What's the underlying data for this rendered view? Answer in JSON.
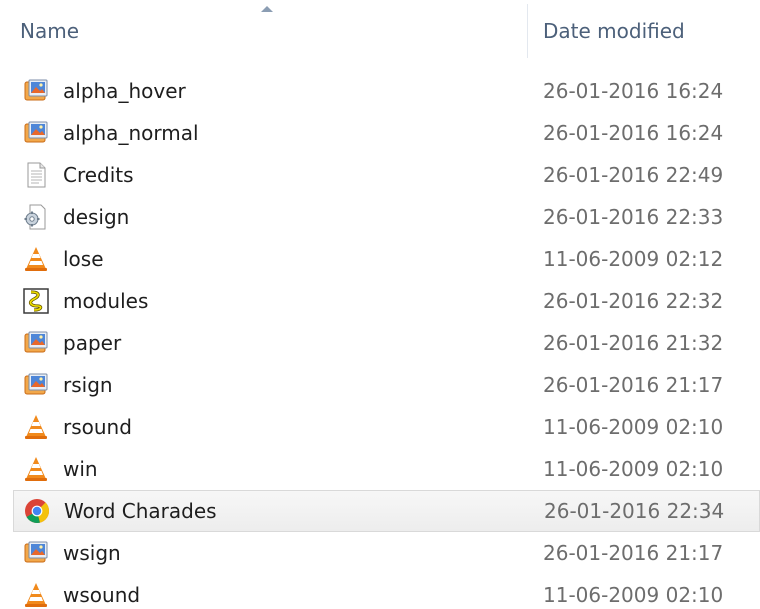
{
  "columns": {
    "name": "Name",
    "date": "Date modified"
  },
  "files": [
    {
      "name": "alpha_hover",
      "date": "26-01-2016 16:24",
      "icon": "image-file-icon"
    },
    {
      "name": "alpha_normal",
      "date": "26-01-2016 16:24",
      "icon": "image-file-icon"
    },
    {
      "name": "Credits",
      "date": "26-01-2016 22:49",
      "icon": "text-file-icon"
    },
    {
      "name": "design",
      "date": "26-01-2016 22:33",
      "icon": "config-file-icon"
    },
    {
      "name": "lose",
      "date": "11-06-2009 02:12",
      "icon": "vlc-media-icon"
    },
    {
      "name": "modules",
      "date": "26-01-2016 22:32",
      "icon": "script-file-icon"
    },
    {
      "name": "paper",
      "date": "26-01-2016 21:32",
      "icon": "image-file-icon"
    },
    {
      "name": "rsign",
      "date": "26-01-2016 21:17",
      "icon": "image-file-icon"
    },
    {
      "name": "rsound",
      "date": "11-06-2009 02:10",
      "icon": "vlc-media-icon"
    },
    {
      "name": "win",
      "date": "11-06-2009 02:10",
      "icon": "vlc-media-icon"
    },
    {
      "name": "Word Charades",
      "date": "26-01-2016 22:34",
      "icon": "chrome-html-icon",
      "hover": true
    },
    {
      "name": "wsign",
      "date": "26-01-2016 21:17",
      "icon": "image-file-icon"
    },
    {
      "name": "wsound",
      "date": "11-06-2009 02:10",
      "icon": "vlc-media-icon"
    }
  ]
}
